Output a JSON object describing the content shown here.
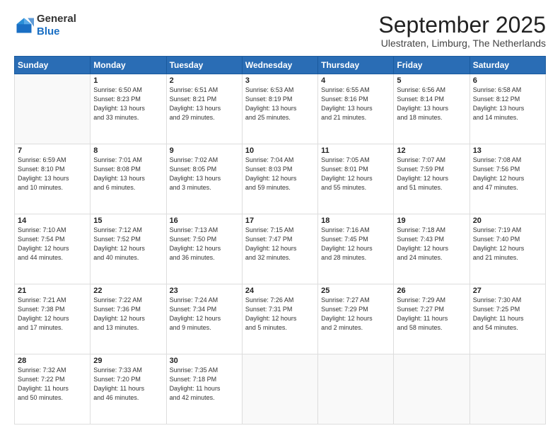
{
  "header": {
    "logo_general": "General",
    "logo_blue": "Blue",
    "month_title": "September 2025",
    "location": "Ulestraten, Limburg, The Netherlands"
  },
  "weekdays": [
    "Sunday",
    "Monday",
    "Tuesday",
    "Wednesday",
    "Thursday",
    "Friday",
    "Saturday"
  ],
  "weeks": [
    [
      {
        "day": "",
        "text": ""
      },
      {
        "day": "1",
        "text": "Sunrise: 6:50 AM\nSunset: 8:23 PM\nDaylight: 13 hours\nand 33 minutes."
      },
      {
        "day": "2",
        "text": "Sunrise: 6:51 AM\nSunset: 8:21 PM\nDaylight: 13 hours\nand 29 minutes."
      },
      {
        "day": "3",
        "text": "Sunrise: 6:53 AM\nSunset: 8:19 PM\nDaylight: 13 hours\nand 25 minutes."
      },
      {
        "day": "4",
        "text": "Sunrise: 6:55 AM\nSunset: 8:16 PM\nDaylight: 13 hours\nand 21 minutes."
      },
      {
        "day": "5",
        "text": "Sunrise: 6:56 AM\nSunset: 8:14 PM\nDaylight: 13 hours\nand 18 minutes."
      },
      {
        "day": "6",
        "text": "Sunrise: 6:58 AM\nSunset: 8:12 PM\nDaylight: 13 hours\nand 14 minutes."
      }
    ],
    [
      {
        "day": "7",
        "text": "Sunrise: 6:59 AM\nSunset: 8:10 PM\nDaylight: 13 hours\nand 10 minutes."
      },
      {
        "day": "8",
        "text": "Sunrise: 7:01 AM\nSunset: 8:08 PM\nDaylight: 13 hours\nand 6 minutes."
      },
      {
        "day": "9",
        "text": "Sunrise: 7:02 AM\nSunset: 8:05 PM\nDaylight: 13 hours\nand 3 minutes."
      },
      {
        "day": "10",
        "text": "Sunrise: 7:04 AM\nSunset: 8:03 PM\nDaylight: 12 hours\nand 59 minutes."
      },
      {
        "day": "11",
        "text": "Sunrise: 7:05 AM\nSunset: 8:01 PM\nDaylight: 12 hours\nand 55 minutes."
      },
      {
        "day": "12",
        "text": "Sunrise: 7:07 AM\nSunset: 7:59 PM\nDaylight: 12 hours\nand 51 minutes."
      },
      {
        "day": "13",
        "text": "Sunrise: 7:08 AM\nSunset: 7:56 PM\nDaylight: 12 hours\nand 47 minutes."
      }
    ],
    [
      {
        "day": "14",
        "text": "Sunrise: 7:10 AM\nSunset: 7:54 PM\nDaylight: 12 hours\nand 44 minutes."
      },
      {
        "day": "15",
        "text": "Sunrise: 7:12 AM\nSunset: 7:52 PM\nDaylight: 12 hours\nand 40 minutes."
      },
      {
        "day": "16",
        "text": "Sunrise: 7:13 AM\nSunset: 7:50 PM\nDaylight: 12 hours\nand 36 minutes."
      },
      {
        "day": "17",
        "text": "Sunrise: 7:15 AM\nSunset: 7:47 PM\nDaylight: 12 hours\nand 32 minutes."
      },
      {
        "day": "18",
        "text": "Sunrise: 7:16 AM\nSunset: 7:45 PM\nDaylight: 12 hours\nand 28 minutes."
      },
      {
        "day": "19",
        "text": "Sunrise: 7:18 AM\nSunset: 7:43 PM\nDaylight: 12 hours\nand 24 minutes."
      },
      {
        "day": "20",
        "text": "Sunrise: 7:19 AM\nSunset: 7:40 PM\nDaylight: 12 hours\nand 21 minutes."
      }
    ],
    [
      {
        "day": "21",
        "text": "Sunrise: 7:21 AM\nSunset: 7:38 PM\nDaylight: 12 hours\nand 17 minutes."
      },
      {
        "day": "22",
        "text": "Sunrise: 7:22 AM\nSunset: 7:36 PM\nDaylight: 12 hours\nand 13 minutes."
      },
      {
        "day": "23",
        "text": "Sunrise: 7:24 AM\nSunset: 7:34 PM\nDaylight: 12 hours\nand 9 minutes."
      },
      {
        "day": "24",
        "text": "Sunrise: 7:26 AM\nSunset: 7:31 PM\nDaylight: 12 hours\nand 5 minutes."
      },
      {
        "day": "25",
        "text": "Sunrise: 7:27 AM\nSunset: 7:29 PM\nDaylight: 12 hours\nand 2 minutes."
      },
      {
        "day": "26",
        "text": "Sunrise: 7:29 AM\nSunset: 7:27 PM\nDaylight: 11 hours\nand 58 minutes."
      },
      {
        "day": "27",
        "text": "Sunrise: 7:30 AM\nSunset: 7:25 PM\nDaylight: 11 hours\nand 54 minutes."
      }
    ],
    [
      {
        "day": "28",
        "text": "Sunrise: 7:32 AM\nSunset: 7:22 PM\nDaylight: 11 hours\nand 50 minutes."
      },
      {
        "day": "29",
        "text": "Sunrise: 7:33 AM\nSunset: 7:20 PM\nDaylight: 11 hours\nand 46 minutes."
      },
      {
        "day": "30",
        "text": "Sunrise: 7:35 AM\nSunset: 7:18 PM\nDaylight: 11 hours\nand 42 minutes."
      },
      {
        "day": "",
        "text": ""
      },
      {
        "day": "",
        "text": ""
      },
      {
        "day": "",
        "text": ""
      },
      {
        "day": "",
        "text": ""
      }
    ]
  ]
}
